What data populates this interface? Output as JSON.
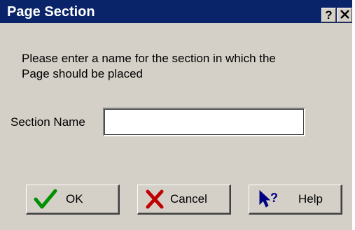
{
  "window": {
    "title": "Page Section",
    "help_glyph": "?",
    "close_glyph": "✕"
  },
  "prompt": {
    "text": "Please enter a name for the section in which the\nPage should be placed"
  },
  "section_name": {
    "label": "Section Name",
    "value": ""
  },
  "buttons": {
    "ok": {
      "label": "OK",
      "icon": "checkmark-icon",
      "color": "#008000"
    },
    "cancel": {
      "label": "Cancel",
      "icon": "x-icon",
      "color": "#c00000"
    },
    "help": {
      "label": "Help",
      "icon": "help-pointer-icon",
      "color": "#0a246a"
    }
  },
  "colors": {
    "titlebar": "#0a246a",
    "dialog_face": "#d4d0c8"
  }
}
